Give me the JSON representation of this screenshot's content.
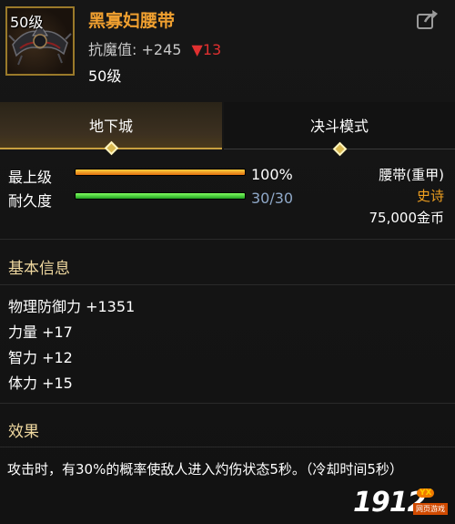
{
  "header": {
    "icon_level": "50级",
    "item_name": "黑寡妇腰带",
    "stat_label": "抗魔值:",
    "stat_value": "+245",
    "stat_change": "▼13",
    "level": "50级"
  },
  "tabs": [
    {
      "label": "地下城",
      "active": true
    },
    {
      "label": "决斗模式",
      "active": false
    }
  ],
  "bars": {
    "top": {
      "label": "最上级",
      "value": "100%",
      "fill": 1.0
    },
    "durability": {
      "label": "耐久度",
      "value": "30/30",
      "fill": 1.0
    }
  },
  "item_info": {
    "type": "腰带(重甲)",
    "rarity": "史诗",
    "price": "75,000金币"
  },
  "basic_info": {
    "title": "基本信息",
    "attributes": [
      "物理防御力 +1351",
      "力量 +17",
      "智力 +12",
      "体力 +15"
    ]
  },
  "effect": {
    "title": "效果",
    "text": "攻击时，有30%的概率使敌人进入灼伤状态5秒。（冷却时间5秒）"
  },
  "watermark": {
    "number": "1912",
    "badge": "YX",
    "sub": "网页游戏"
  },
  "colors": {
    "item_name": "#f0a030",
    "rarity": "#f0a020",
    "stat_down": "#e03030",
    "accent": "#c8a040"
  },
  "icons": {
    "share": "share-icon",
    "item": "belt-icon"
  }
}
